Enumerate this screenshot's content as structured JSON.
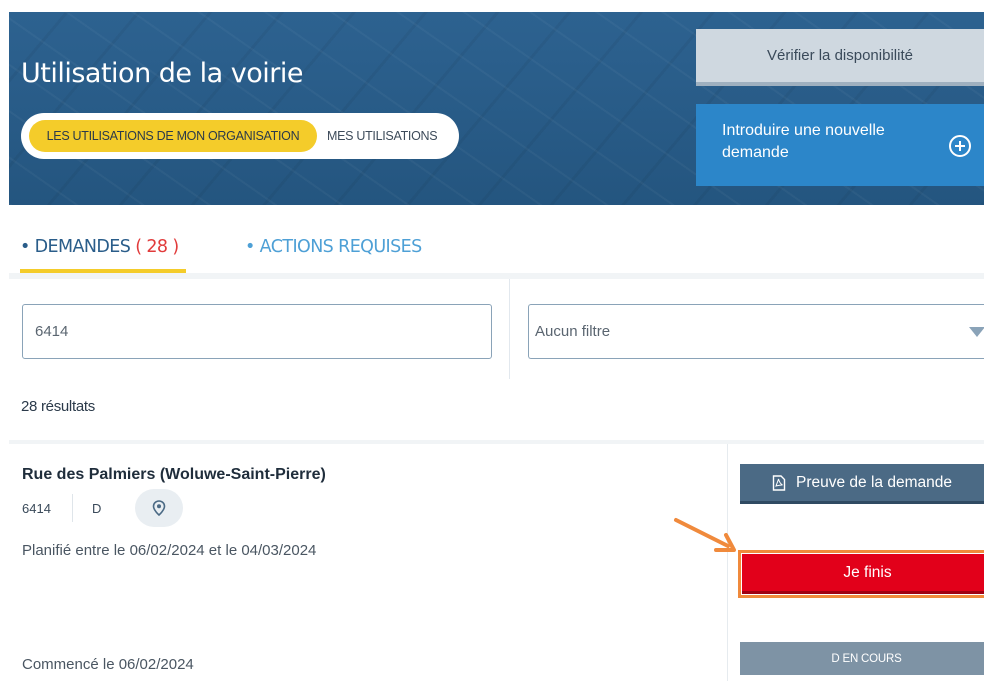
{
  "header": {
    "title": "Utilisation de la voirie",
    "toggle": {
      "active_label": "LES UTILISATIONS DE MON ORGANISATION",
      "inactive_label": "MES UTILISATIONS"
    },
    "verify_button": "Vérifier la disponibilité",
    "new_request_button": "Introduire une nouvelle demande"
  },
  "tabs": {
    "demandes": {
      "prefix": "• DEMANDES ",
      "count": "( 28 )"
    },
    "actions": "• ACTIONS REQUISES"
  },
  "filters": {
    "search_value": "6414",
    "filter_select": "Aucun filtre"
  },
  "results": {
    "count_text": "28 résultats"
  },
  "result_card": {
    "street": "Rue des Palmiers (Woluwe-Saint-Pierre)",
    "reference": "6414",
    "code": "D",
    "planned": "Planifié entre le 06/02/2024 et le 04/03/2024",
    "started": "Commencé le 06/02/2024",
    "proof_button": "Preuve de la demande",
    "finish_button": "Je finis",
    "status": "D EN COURS"
  },
  "colors": {
    "header_bg": "#2a5d8a",
    "accent_yellow": "#f4cc2a",
    "primary_blue": "#2c86c9",
    "finish_red": "#e2001a",
    "annotation_orange": "#f08a3c"
  }
}
